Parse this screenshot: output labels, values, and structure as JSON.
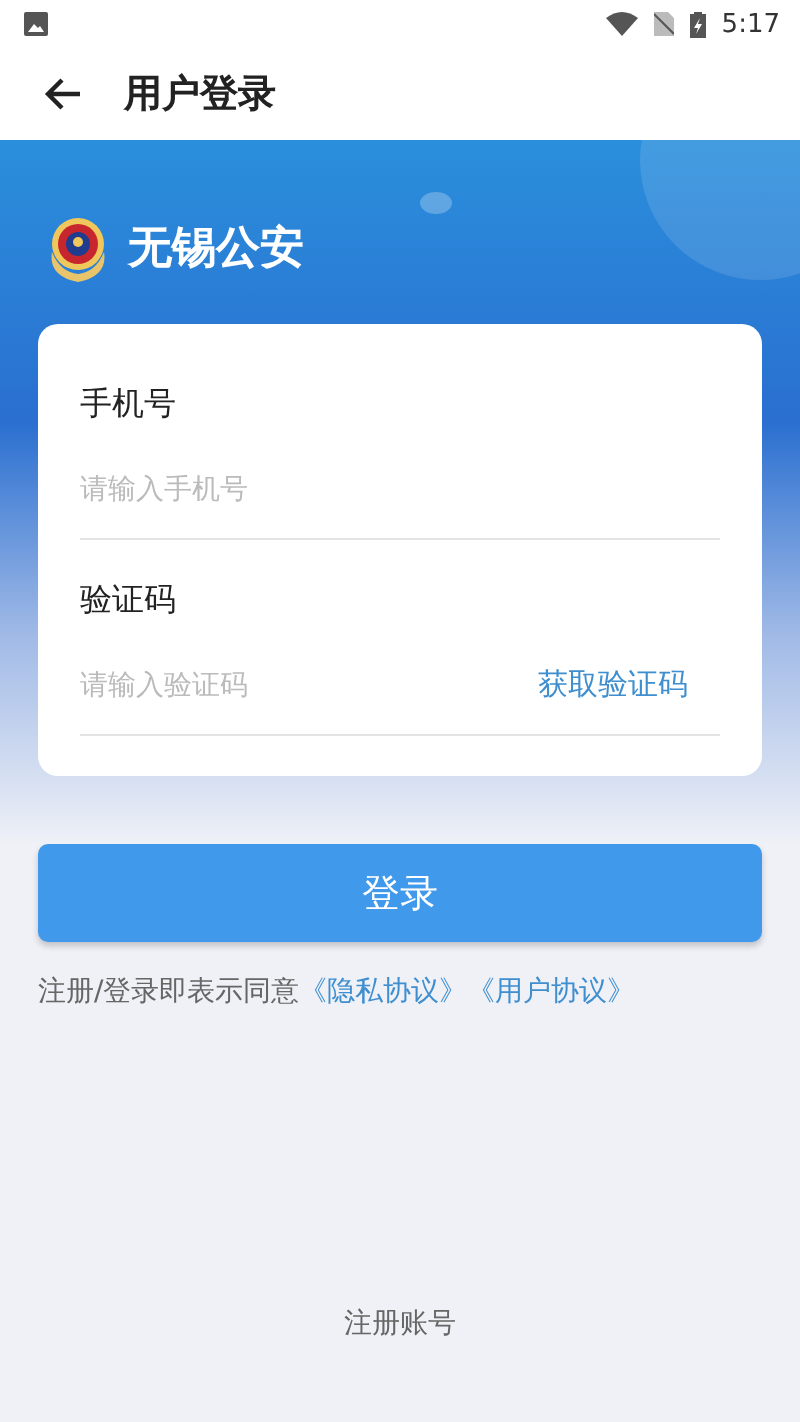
{
  "status_bar": {
    "time": "5:17"
  },
  "app_bar": {
    "title": "用户登录"
  },
  "brand": {
    "name": "无锡公安"
  },
  "form": {
    "fields": [
      {
        "label": "手机号",
        "placeholder": "请输入手机号"
      },
      {
        "label": "验证码",
        "placeholder": "请输入验证码",
        "action": "获取验证码"
      }
    ]
  },
  "login_button": "登录",
  "agreement": {
    "text": "注册/登录即表示同意",
    "links": [
      "《隐私协议》",
      "《用户协议》"
    ]
  },
  "register_link": "注册账号"
}
